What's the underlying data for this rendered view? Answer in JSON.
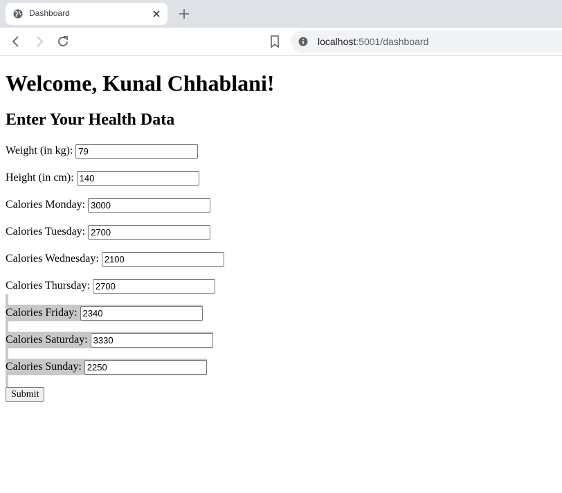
{
  "browser": {
    "tab_title": "Dashboard",
    "url_host": "localhost",
    "url_path": ":5001/dashboard"
  },
  "page": {
    "heading": "Welcome, Kunal Chhablani!",
    "subheading": "Enter Your Health Data",
    "fields": [
      {
        "label": "Weight (in kg):",
        "value": "79"
      },
      {
        "label": "Height (in cm):",
        "value": "140"
      },
      {
        "label": "Calories Monday:",
        "value": "3000"
      },
      {
        "label": "Calories Tuesday:",
        "value": "2700"
      },
      {
        "label": "Calories Wednesday:",
        "value": "2100"
      },
      {
        "label": "Calories Thursday:",
        "value": "2700"
      },
      {
        "label": "Calories Friday:",
        "value": "2340"
      },
      {
        "label": "Calories Saturday:",
        "value": "3330"
      },
      {
        "label": "Calories Sunday:",
        "value": "2250"
      }
    ],
    "submit_label": "Submit"
  },
  "icons": {
    "favicon": "globe-icon",
    "tab_close": "close-icon",
    "new_tab": "plus-icon",
    "back": "back-arrow-icon",
    "forward": "forward-arrow-icon",
    "reload": "reload-icon",
    "bookmark": "bookmark-icon",
    "site_info": "info-icon"
  }
}
